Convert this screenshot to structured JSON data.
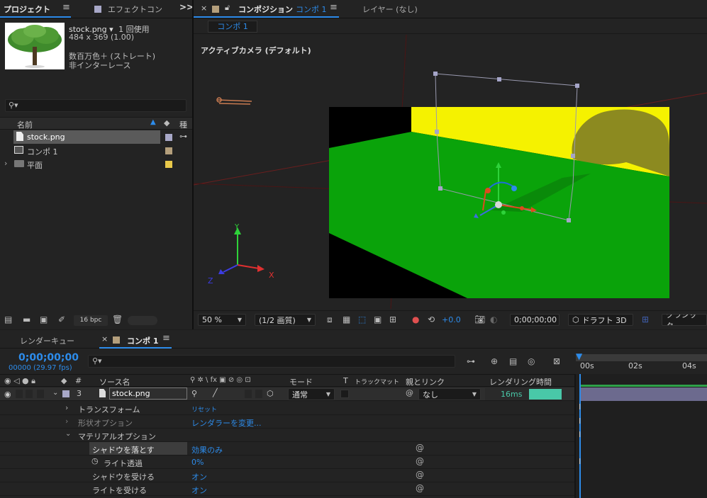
{
  "project": {
    "tab_label": "プロジェクト",
    "menu_icon": "hamburger-icon",
    "effects_tab": "エフェクトコン",
    "overflow_icon": ">>",
    "asset": {
      "name": "stock.png ▾",
      "usage": "1 回使用",
      "dimensions": "484 x 369 (1.00)",
      "color_info": "数百万色＋ (ストレート)",
      "interlace": "非インターレース"
    },
    "search_placeholder": "",
    "col_name": "名前",
    "col_type": "種",
    "items": [
      {
        "name": "stock.png",
        "icon": "image-file-icon",
        "color": "#a8a8c8",
        "selected": true
      },
      {
        "name": "コンポ 1",
        "icon": "composition-icon",
        "color": "#b49f7c",
        "selected": false
      },
      {
        "name": "平面",
        "icon": "folder-icon",
        "color": "#e8c84a",
        "selected": false
      }
    ],
    "bpc_label": "16 bpc"
  },
  "viewer": {
    "close_icon": "×",
    "tab_label": "コンポジション",
    "comp_name": "コンポ 1",
    "layer_tab": "レイヤー (なし)",
    "subtab": "コンポ 1",
    "camera_label": "アクティブカメラ (デフォルト)",
    "axis_x": "X",
    "axis_y": "Y",
    "axis_z": "Z",
    "zoom": "50 %",
    "resolution": "(1/2 画質)",
    "exposure": "+0.0",
    "timecode": "0;00;00;00",
    "renderer": "ドラフト 3D",
    "mode": "クラシック",
    "colors": {
      "floor": "#0aa30a",
      "wall": "#f5f200",
      "bg": "#000000"
    }
  },
  "timeline": {
    "render_queue_tab": "レンダーキュー",
    "comp_tab": "コンポ 1",
    "timecode": "0;00;00;00",
    "fps": "00000 (29.97 fps)",
    "search_placeholder": "",
    "ruler": [
      "00s",
      "02s",
      "04s"
    ],
    "headers": {
      "num": "#",
      "source": "ソース名",
      "switches": "⚲ ✲ \\ fx ▣ ⊘ ◎ ⊡",
      "mode": "モード",
      "t": "T",
      "trackmatte": "トラックマット",
      "parent": "親とリンク",
      "render_time": "レンダリング時間"
    },
    "layer": {
      "number": "3",
      "name": "stock.png",
      "mode": "通常",
      "parent": "なし",
      "render_time": "16ms",
      "render_fraction": 0.6
    },
    "props": {
      "transform": "トランスフォーム",
      "transform_value": "リセット",
      "geometry": "形状オプション",
      "geometry_value": "レンダラーを変更...",
      "material": "マテリアルオプション",
      "cast_shadows": "シャドウを落とす",
      "cast_shadows_value": "効果のみ",
      "light_transmission": "ライト透過",
      "light_transmission_value": "0%",
      "accept_shadows": "シャドウを受ける",
      "accept_shadows_value": "オン",
      "accept_lights": "ライトを受ける",
      "accept_lights_value": "オン"
    }
  }
}
